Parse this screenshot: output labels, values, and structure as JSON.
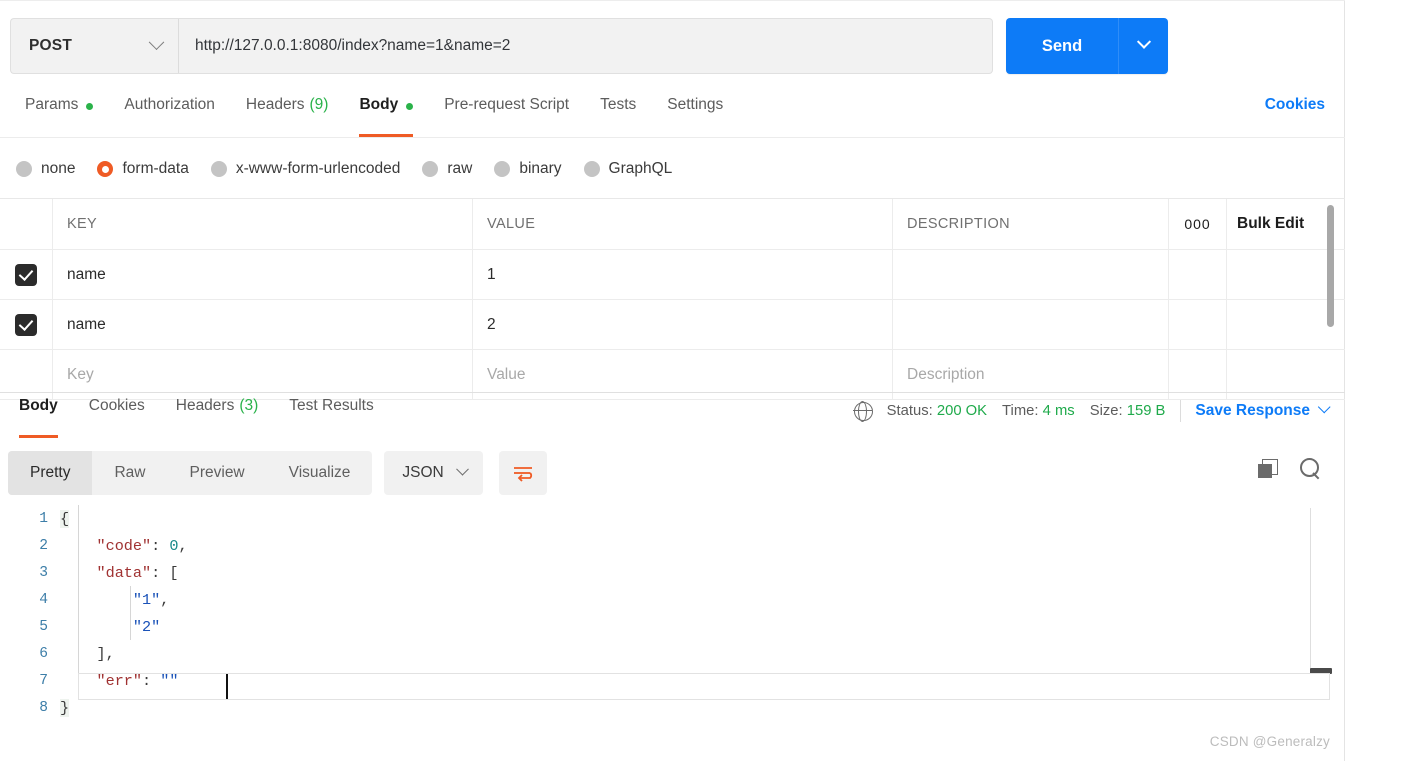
{
  "request": {
    "method": "POST",
    "url": "http://127.0.0.1:8080/index?name=1&name=2",
    "send_label": "Send",
    "tabs": [
      {
        "label": "Params",
        "badge_dot": true,
        "count": "",
        "active": false
      },
      {
        "label": "Authorization",
        "badge_dot": false,
        "count": "",
        "active": false
      },
      {
        "label": "Headers",
        "badge_dot": false,
        "count": "(9)",
        "active": false
      },
      {
        "label": "Body",
        "badge_dot": true,
        "count": "",
        "active": true
      },
      {
        "label": "Pre-request Script",
        "badge_dot": false,
        "count": "",
        "active": false
      },
      {
        "label": "Tests",
        "badge_dot": false,
        "count": "",
        "active": false
      },
      {
        "label": "Settings",
        "badge_dot": false,
        "count": "",
        "active": false
      }
    ],
    "cookies_label": "Cookies"
  },
  "body_types": [
    {
      "label": "none",
      "selected": false
    },
    {
      "label": "form-data",
      "selected": true
    },
    {
      "label": "x-www-form-urlencoded",
      "selected": false
    },
    {
      "label": "raw",
      "selected": false
    },
    {
      "label": "binary",
      "selected": false
    },
    {
      "label": "GraphQL",
      "selected": false
    }
  ],
  "params_table": {
    "headers": {
      "key": "KEY",
      "value": "VALUE",
      "description": "DESCRIPTION"
    },
    "more_label": "000",
    "bulk_edit_label": "Bulk Edit",
    "rows": [
      {
        "checked": true,
        "key": "name",
        "value": "1",
        "description": ""
      },
      {
        "checked": true,
        "key": "name",
        "value": "2",
        "description": ""
      }
    ],
    "placeholder_row": {
      "key": "Key",
      "value": "Value",
      "description": "Description"
    }
  },
  "response": {
    "tabs": [
      {
        "label": "Body",
        "count": "",
        "active": true
      },
      {
        "label": "Cookies",
        "count": "",
        "active": false
      },
      {
        "label": "Headers",
        "count": "(3)",
        "active": false
      },
      {
        "label": "Test Results",
        "count": "",
        "active": false
      }
    ],
    "status_label": "Status:",
    "status_value": "200 OK",
    "time_label": "Time:",
    "time_value": "4 ms",
    "size_label": "Size:",
    "size_value": "159 B",
    "save_response_label": "Save Response",
    "format_tabs": [
      {
        "label": "Pretty",
        "active": true
      },
      {
        "label": "Raw",
        "active": false
      },
      {
        "label": "Preview",
        "active": false
      },
      {
        "label": "Visualize",
        "active": false
      }
    ],
    "language": "JSON",
    "code_lines": [
      {
        "no": "1",
        "tokens": [
          {
            "t": "{",
            "c": "brace"
          }
        ]
      },
      {
        "no": "2",
        "tokens": [
          {
            "t": "    ",
            "c": "p"
          },
          {
            "t": "\"code\"",
            "c": "k"
          },
          {
            "t": ": ",
            "c": "p"
          },
          {
            "t": "0",
            "c": "n"
          },
          {
            "t": ",",
            "c": "p"
          }
        ]
      },
      {
        "no": "3",
        "tokens": [
          {
            "t": "    ",
            "c": "p"
          },
          {
            "t": "\"data\"",
            "c": "k"
          },
          {
            "t": ": ",
            "c": "p"
          },
          {
            "t": "[",
            "c": "b"
          }
        ]
      },
      {
        "no": "4",
        "tokens": [
          {
            "t": "        ",
            "c": "p"
          },
          {
            "t": "\"1\"",
            "c": "s"
          },
          {
            "t": ",",
            "c": "p"
          }
        ]
      },
      {
        "no": "5",
        "tokens": [
          {
            "t": "        ",
            "c": "p"
          },
          {
            "t": "\"2\"",
            "c": "s"
          }
        ]
      },
      {
        "no": "6",
        "tokens": [
          {
            "t": "    ",
            "c": "p"
          },
          {
            "t": "]",
            "c": "b"
          },
          {
            "t": ",",
            "c": "p"
          }
        ]
      },
      {
        "no": "7",
        "tokens": [
          {
            "t": "    ",
            "c": "p"
          },
          {
            "t": "\"err\"",
            "c": "k"
          },
          {
            "t": ": ",
            "c": "p"
          },
          {
            "t": "\"\"",
            "c": "s"
          }
        ]
      },
      {
        "no": "8",
        "tokens": [
          {
            "t": "}",
            "c": "brace"
          }
        ]
      }
    ]
  },
  "watermark": "CSDN @Generalzy",
  "colors": {
    "accent_orange": "#ef5b25",
    "accent_blue": "#0d7bf7",
    "status_green": "#1faa4b"
  }
}
